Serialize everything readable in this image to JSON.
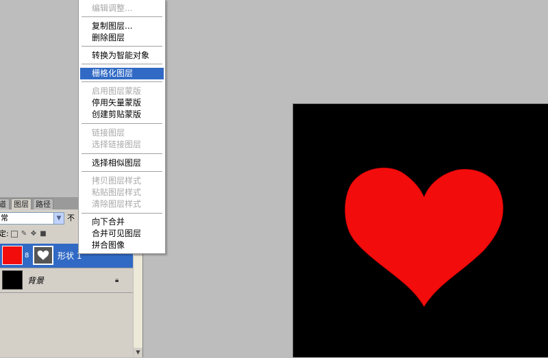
{
  "colors": {
    "app_background": "#bdbdbd",
    "canvas_background": "#000000",
    "shape_fill": "#f20c0c",
    "highlight": "#316ac5",
    "disabled_text": "#a8a8a8"
  },
  "context_menu": {
    "items": [
      {
        "label": "编辑调整...",
        "disabled": true
      },
      {
        "label": "复制图层...",
        "disabled": false
      },
      {
        "label": "删除图层",
        "disabled": false
      },
      {
        "label": "转换为智能对象",
        "disabled": false
      },
      {
        "label": "栅格化图层",
        "disabled": false,
        "highlighted": true
      },
      {
        "label": "启用图层蒙版",
        "disabled": true
      },
      {
        "label": "停用矢量蒙版",
        "disabled": false
      },
      {
        "label": "创建剪贴蒙版",
        "disabled": false
      },
      {
        "label": "链接图层",
        "disabled": true
      },
      {
        "label": "选择链接图层",
        "disabled": true
      },
      {
        "label": "选择相似图层",
        "disabled": false
      },
      {
        "label": "拷贝图层样式",
        "disabled": true
      },
      {
        "label": "粘贴图层样式",
        "disabled": true
      },
      {
        "label": "清除图层样式",
        "disabled": true
      },
      {
        "label": "向下合并",
        "disabled": false
      },
      {
        "label": "合并可见图层",
        "disabled": false
      },
      {
        "label": "拼合图像",
        "disabled": false
      }
    ]
  },
  "layers_panel": {
    "tabs": [
      "道",
      "图层",
      "路径"
    ],
    "active_tab": "图层",
    "blend_mode": "常",
    "opacity_label": "不",
    "lock_label": "定:",
    "layers": [
      {
        "name": "形状 1",
        "selected": true,
        "thumbnail": "red-fill",
        "mask": "heart-vector-mask"
      },
      {
        "name": "背景",
        "selected": false,
        "thumbnail": "black-fill",
        "locked": true
      }
    ]
  },
  "canvas": {
    "shape": "heart-icon"
  }
}
